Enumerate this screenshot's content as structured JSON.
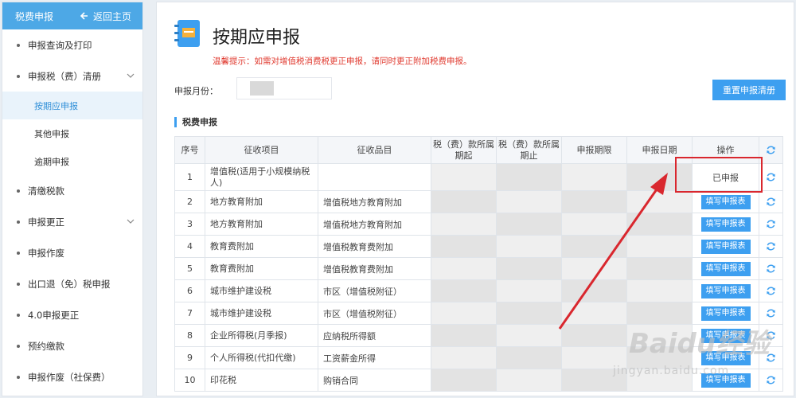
{
  "sidebar": {
    "title": "税费申报",
    "back_label": "返回主页",
    "items": [
      {
        "label": "申报查询及打印",
        "expandable": false
      },
      {
        "label": "申报税（费）清册",
        "expandable": true,
        "children": [
          {
            "label": "按期应申报",
            "active": true
          },
          {
            "label": "其他申报",
            "active": false
          },
          {
            "label": "逾期申报",
            "active": false
          }
        ]
      },
      {
        "label": "清缴税款",
        "expandable": false
      },
      {
        "label": "申报更正",
        "expandable": true
      },
      {
        "label": "申报作废",
        "expandable": false
      },
      {
        "label": "出口退（免）税申报",
        "expandable": false
      },
      {
        "label": "4.0申报更正",
        "expandable": false
      },
      {
        "label": "预约缴款",
        "expandable": false
      },
      {
        "label": "申报作废（社保费）",
        "expandable": false
      }
    ]
  },
  "main": {
    "title": "按期应申报",
    "tip": "温馨提示：如需对增值税消费税更正申报，请同时更正附加税费申报。",
    "month_label": "申报月份：",
    "reset_label": "重置申报清册",
    "section_title": "税费申报"
  },
  "table": {
    "headers": [
      "序号",
      "征收项目",
      "征收品目",
      "税（费）款所属期起",
      "税（费）款所属期止",
      "申报期限",
      "申报日期",
      "操作"
    ],
    "rows": [
      {
        "no": "1",
        "item": "增值税(适用于小规模纳税人)",
        "sub": "",
        "action": "已申报",
        "done": true
      },
      {
        "no": "2",
        "item": "地方教育附加",
        "sub": "增值税地方教育附加",
        "action": "填写申报表",
        "done": false
      },
      {
        "no": "3",
        "item": "地方教育附加",
        "sub": "增值税地方教育附加",
        "action": "填写申报表",
        "done": false
      },
      {
        "no": "4",
        "item": "教育费附加",
        "sub": "增值税教育费附加",
        "action": "填写申报表",
        "done": false
      },
      {
        "no": "5",
        "item": "教育费附加",
        "sub": "增值税教育费附加",
        "action": "填写申报表",
        "done": false
      },
      {
        "no": "6",
        "item": "城市维护建设税",
        "sub": "市区（增值税附征）",
        "action": "填写申报表",
        "done": false
      },
      {
        "no": "7",
        "item": "城市维护建设税",
        "sub": "市区（增值税附征）",
        "action": "填写申报表",
        "done": false
      },
      {
        "no": "8",
        "item": "企业所得税(月季报)",
        "sub": "应纳税所得额",
        "action": "填写申报表",
        "done": false
      },
      {
        "no": "9",
        "item": "个人所得税(代扣代缴)",
        "sub": "工资薪金所得",
        "action": "填写申报表",
        "done": false
      },
      {
        "no": "10",
        "item": "印花税",
        "sub": "购销合同",
        "action": "填写申报表",
        "done": false
      }
    ]
  },
  "watermark": {
    "brand": "Baidu经验",
    "url": "jingyan.baidu.com"
  },
  "colors": {
    "accent": "#3d9ff0",
    "tip": "#e03a2f",
    "highlight": "#d9272e"
  }
}
